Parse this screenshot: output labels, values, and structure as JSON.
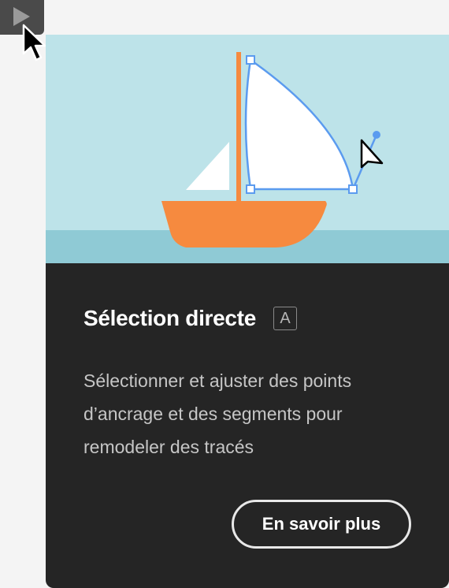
{
  "tool": {
    "icon": "direct-selection-arrow-icon"
  },
  "card": {
    "title": "Sélection directe",
    "shortcut_key": "A",
    "description": "Sélectionner et ajuster des points d’ancrage et des segments pour remodeler des tracés",
    "learn_more_label": "En savoir plus"
  },
  "colors": {
    "sky": "#bde3e9",
    "sea": "#8fcad5",
    "boat": "#f68a3f",
    "mast": "#f68a3f",
    "sail": "#ffffff",
    "path_selection": "#5b9bef",
    "card_background": "#252525",
    "tool_button": "#4a4a4a"
  }
}
